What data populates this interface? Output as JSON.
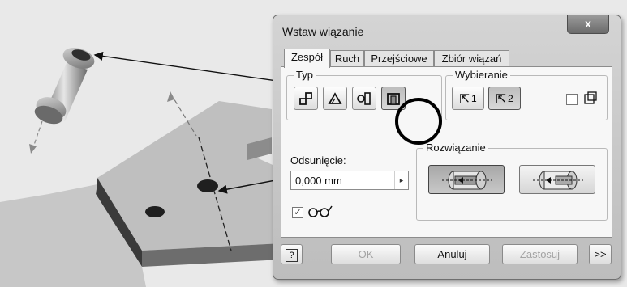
{
  "dialog": {
    "title": "Wstaw wiązanie",
    "close_glyph": "x"
  },
  "tabs": [
    {
      "label": "Zespół",
      "active": true
    },
    {
      "label": "Ruch",
      "active": false
    },
    {
      "label": "Przejściowe",
      "active": false
    },
    {
      "label": "Zbiór wiązań",
      "active": false
    }
  ],
  "type_group": {
    "label": "Typ",
    "buttons": [
      {
        "name": "mate-constraint-button",
        "icon": "mate-icon",
        "pressed": false
      },
      {
        "name": "angle-constraint-button",
        "icon": "angle-icon",
        "pressed": false
      },
      {
        "name": "tangent-constraint-button",
        "icon": "tangent-icon",
        "pressed": false
      },
      {
        "name": "insert-constraint-button",
        "icon": "insert-icon",
        "pressed": true
      }
    ]
  },
  "selection_group": {
    "label": "Wybieranie",
    "select1_label": "1",
    "select2_label": "2",
    "select2_pressed": true,
    "predict_checked": false
  },
  "offset": {
    "label": "Odsunięcie:",
    "value": "0,000 mm"
  },
  "preview": {
    "checked": true,
    "icon": "glasses-icon"
  },
  "solution_group": {
    "label": "Rozwiązanie",
    "buttons": [
      {
        "name": "opposed-solution-button",
        "icon": "opposed-icon",
        "pressed": true
      },
      {
        "name": "aligned-solution-button",
        "icon": "aligned-icon",
        "pressed": false
      }
    ]
  },
  "footer": {
    "help_glyph": "?",
    "ok_label": "OK",
    "cancel_label": "Anuluj",
    "apply_label": "Zastosuj",
    "more_label": ">>"
  },
  "colors": {
    "dialog_bg": "#cbcbcb",
    "panel_bg": "#f7f7f7",
    "viewport_bg": "#e9e9e9",
    "part_face": "#bdbdbd",
    "highlight_circle": "#000000"
  }
}
